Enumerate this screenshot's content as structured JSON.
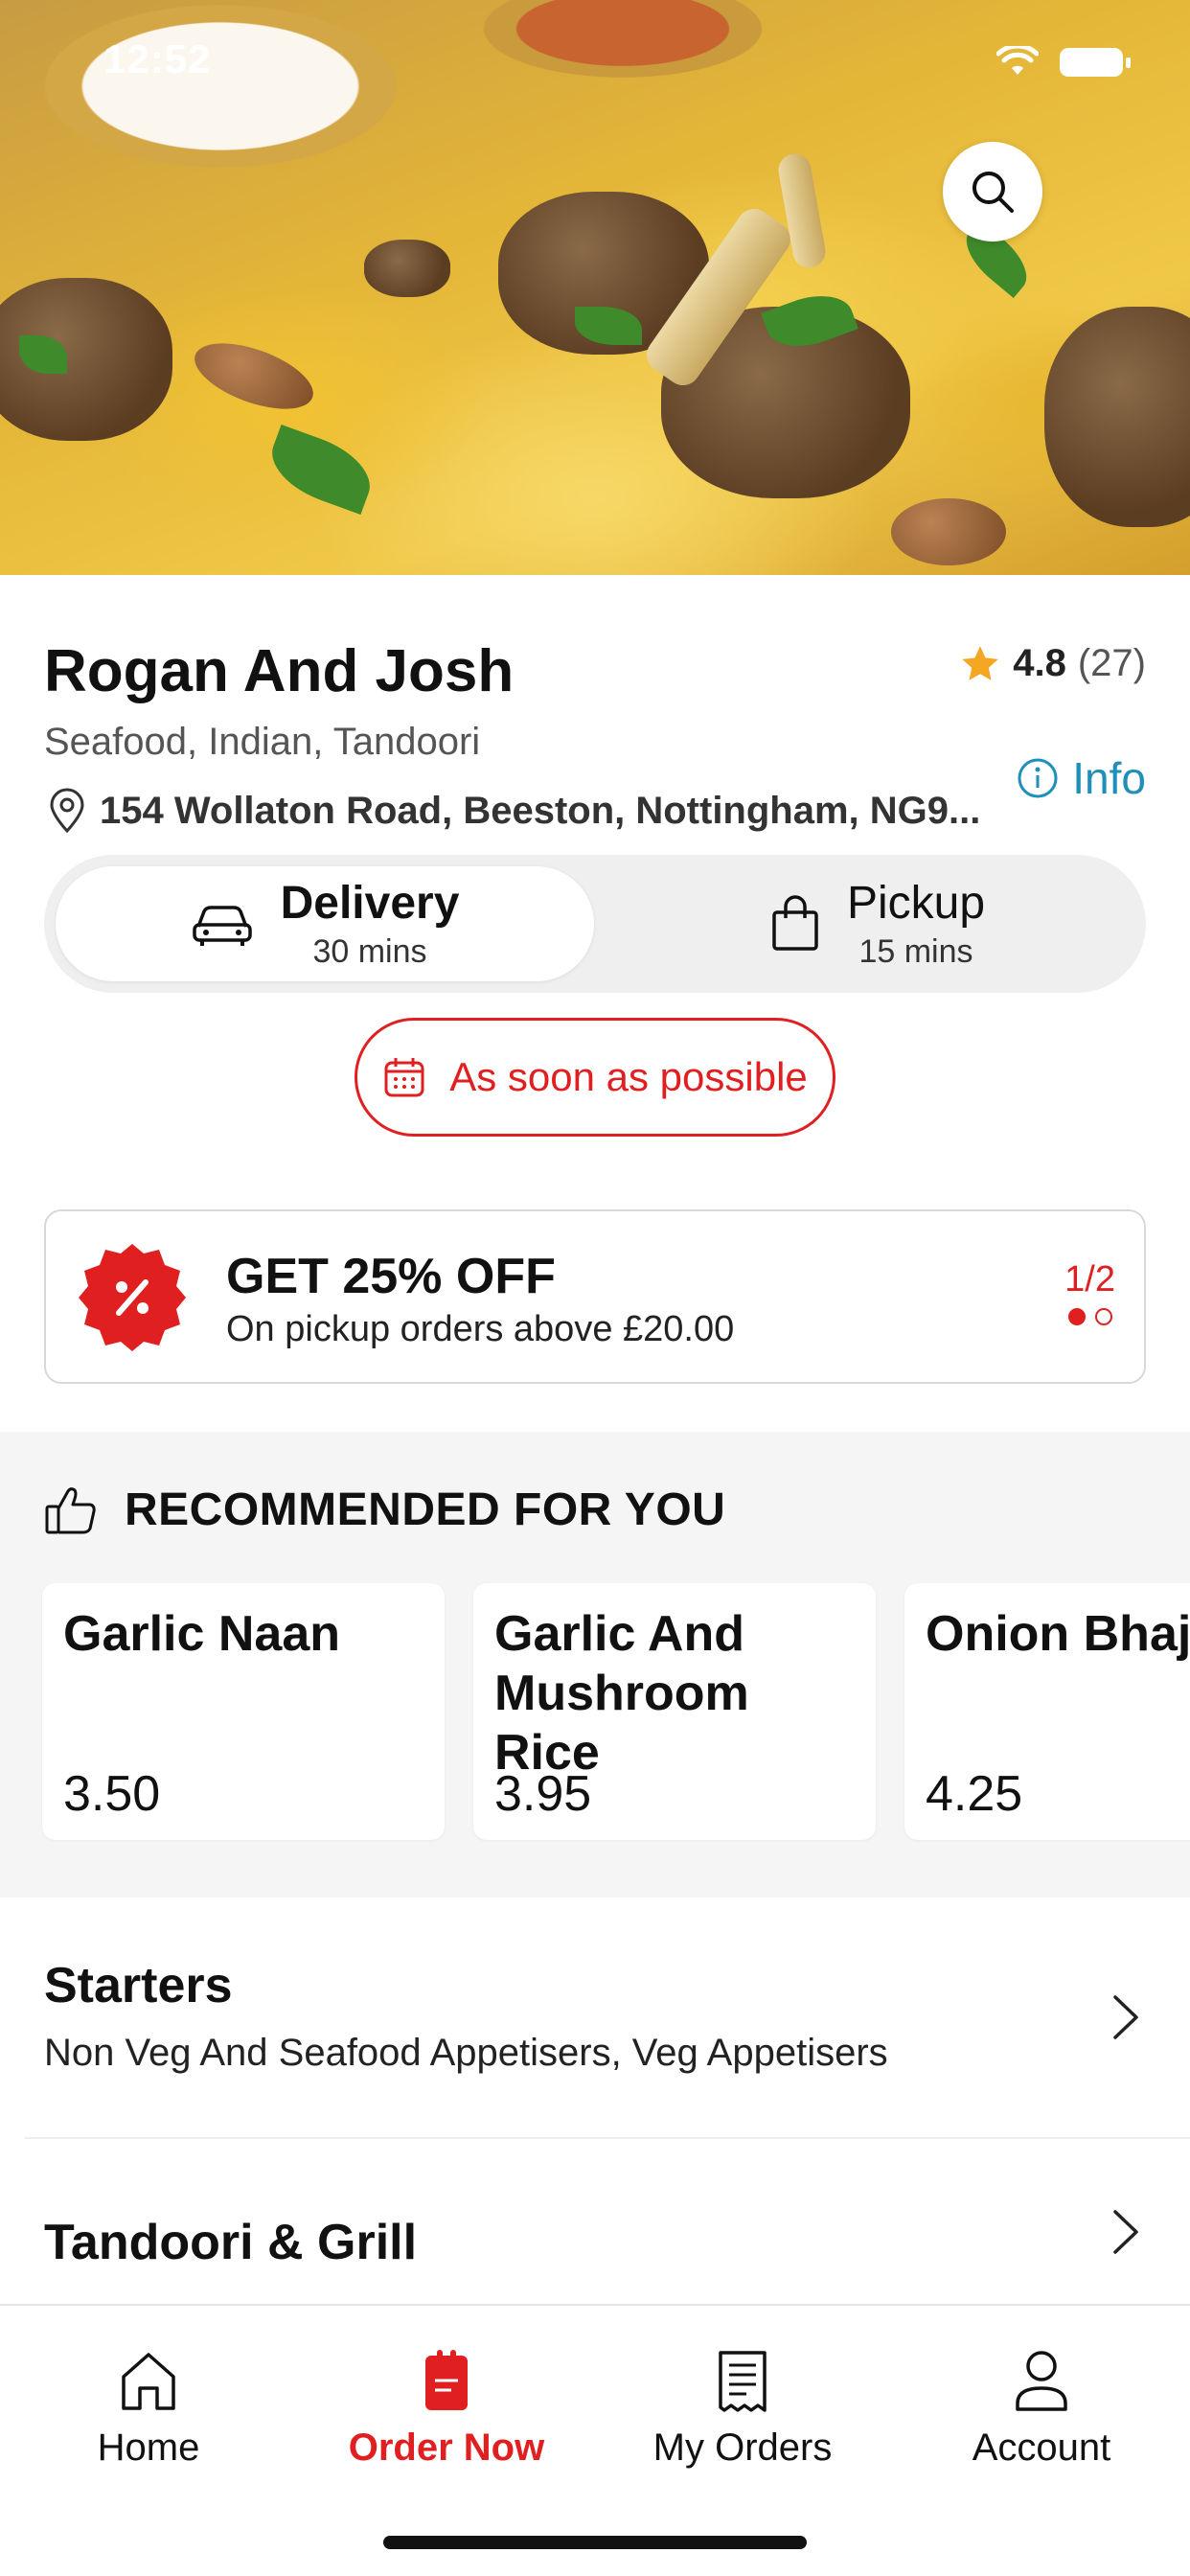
{
  "status_bar": {
    "time": "12:52"
  },
  "restaurant": {
    "name": "Rogan And Josh",
    "rating": "4.8",
    "rating_count": "(27)",
    "cuisines": "Seafood, Indian, Tandoori",
    "info_label": "Info",
    "address": "154 Wollaton Road, Beeston, Nottingham, NG9..."
  },
  "order_modes": {
    "delivery": {
      "label": "Delivery",
      "time": "30 mins",
      "selected": true
    },
    "pickup": {
      "label": "Pickup",
      "time": "15 mins",
      "selected": false
    }
  },
  "schedule": {
    "label": "As soon as possible"
  },
  "offer": {
    "title": "GET 25% OFF",
    "subtitle": "On pickup orders above £20.00",
    "pager": "1/2"
  },
  "recommended": {
    "heading": "RECOMMENDED FOR YOU",
    "items": [
      {
        "name": "Garlic Naan",
        "price": "3.50"
      },
      {
        "name": "Garlic And Mushroom Rice",
        "price": "3.95"
      },
      {
        "name": "Onion Bhaji",
        "price": "4.25"
      }
    ]
  },
  "categories": [
    {
      "name": "Starters",
      "description": "Non Veg And Seafood Appetisers, Veg Appetisers"
    },
    {
      "name": "Tandoori & Grill",
      "description": ""
    }
  ],
  "tab_bar": {
    "items": [
      {
        "label": "Home",
        "icon": "home-icon",
        "active": false
      },
      {
        "label": "Order Now",
        "icon": "order-icon",
        "active": true
      },
      {
        "label": "My Orders",
        "icon": "receipt-icon",
        "active": false
      },
      {
        "label": "Account",
        "icon": "person-icon",
        "active": false
      }
    ]
  },
  "colors": {
    "accent": "#e02020",
    "info": "#1e8fb8",
    "star": "#f5a623"
  }
}
